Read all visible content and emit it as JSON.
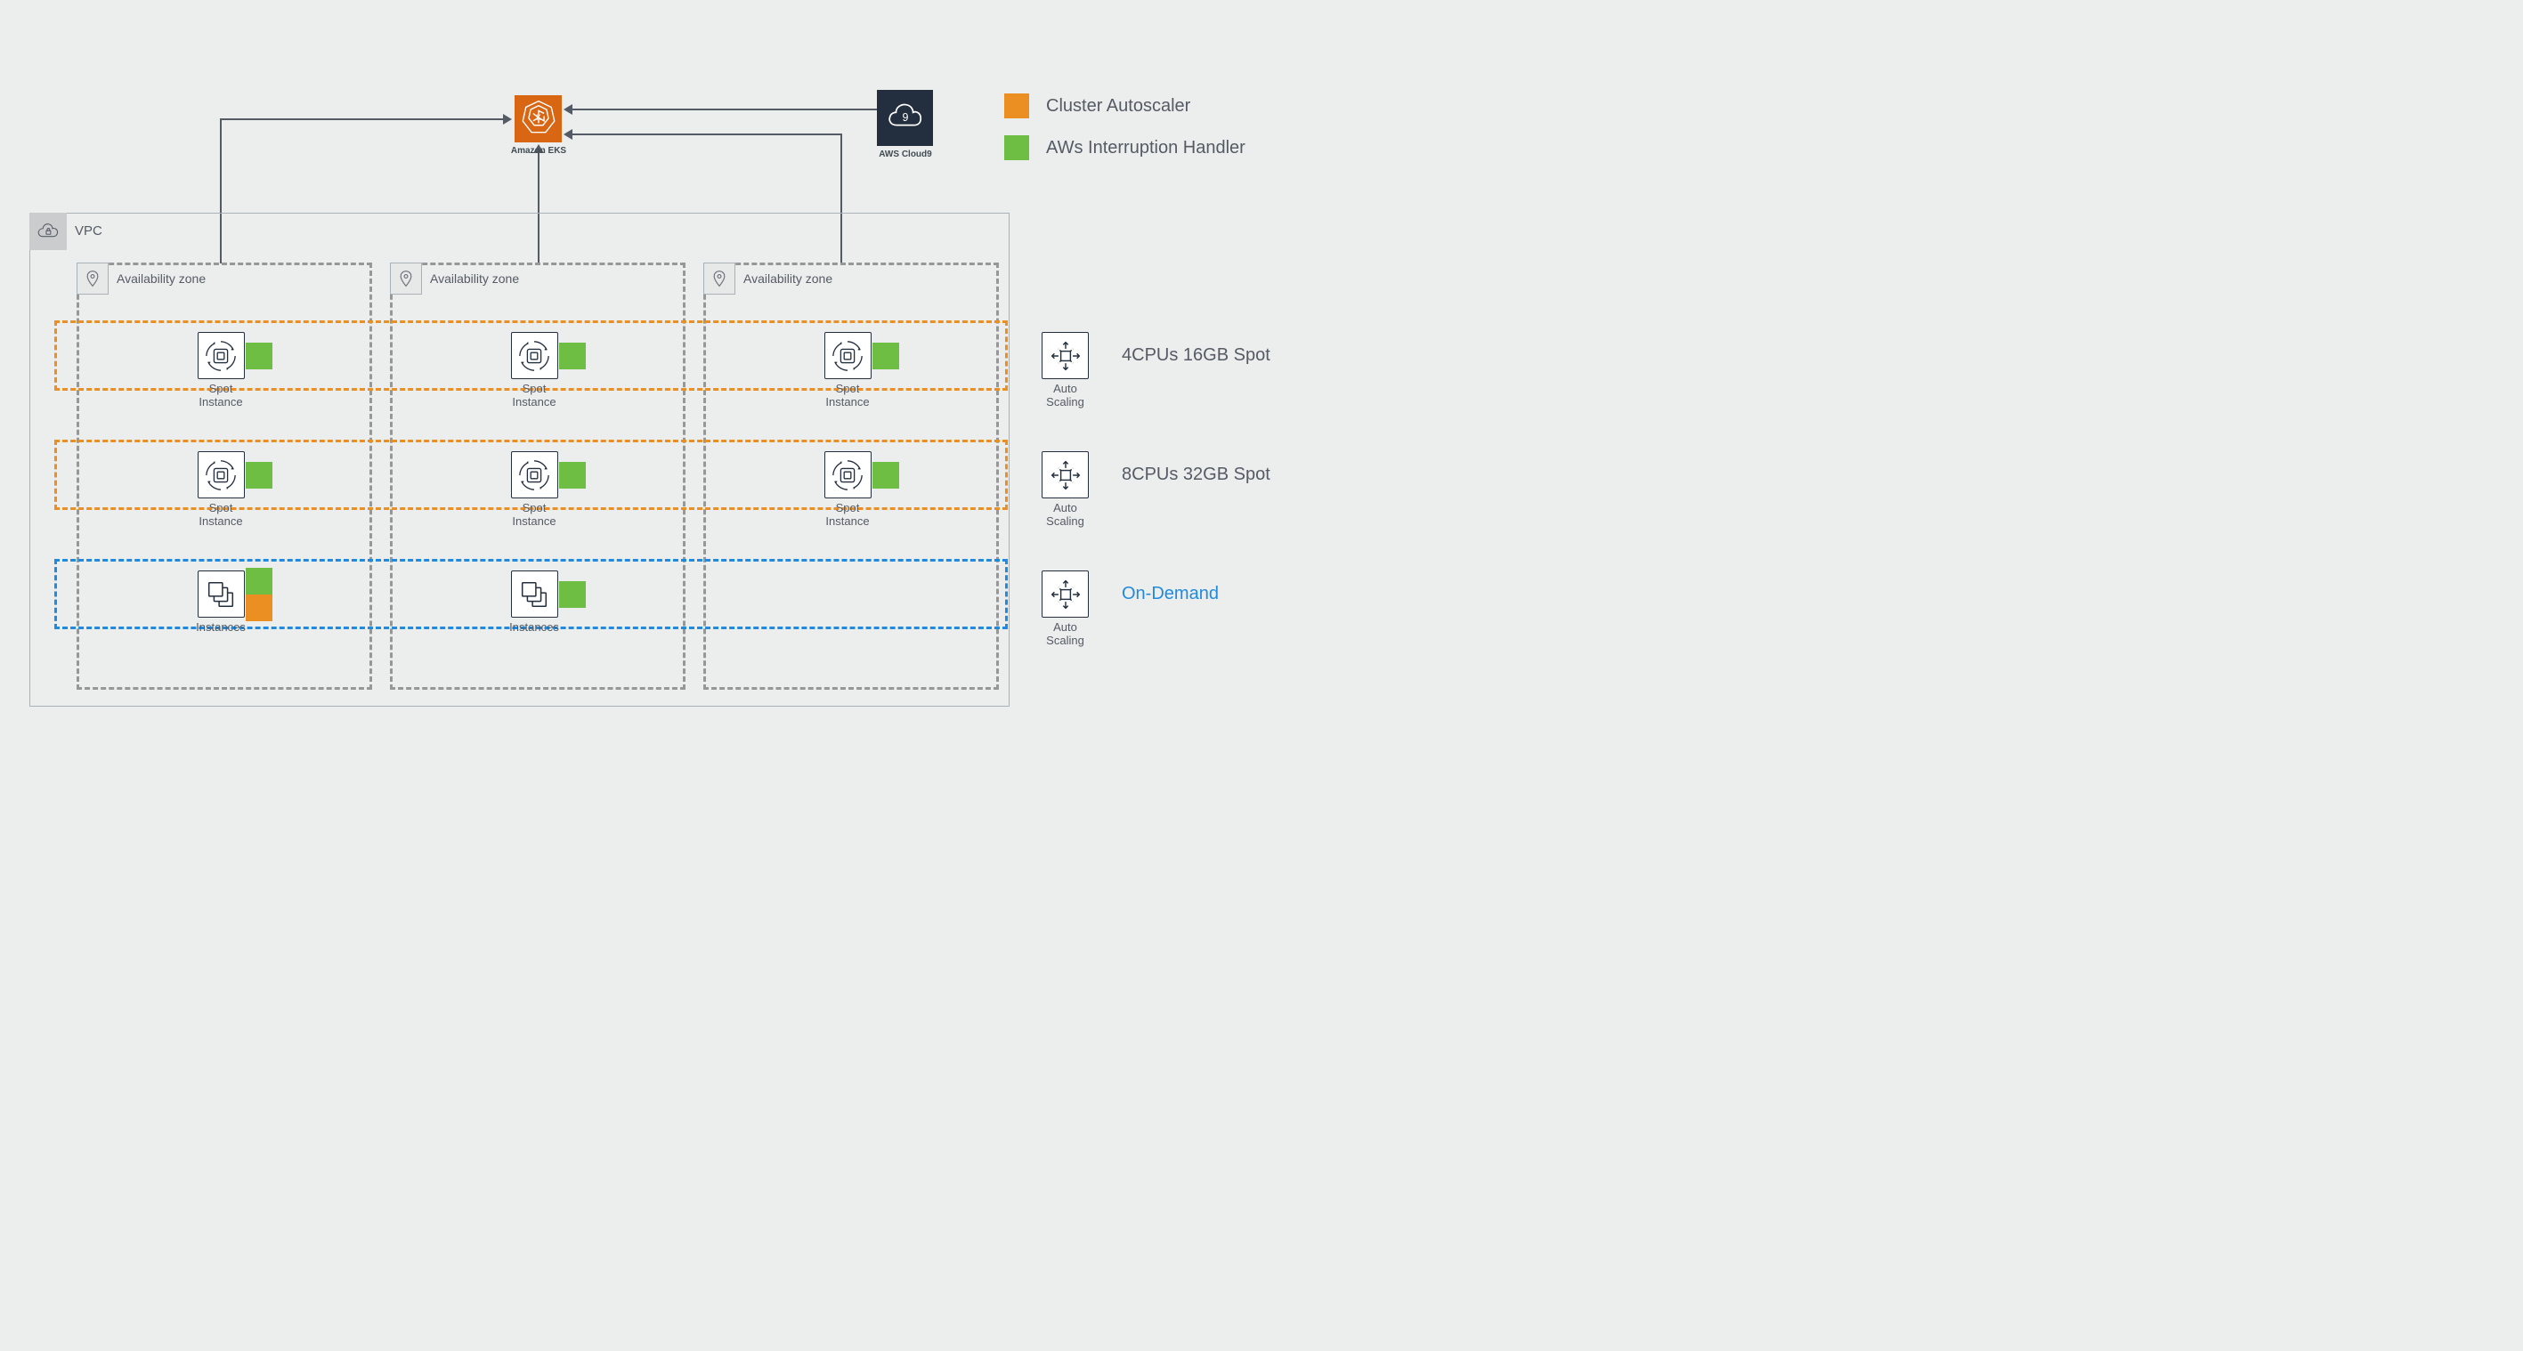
{
  "eks": {
    "label": "Amazon EKS"
  },
  "cloud9": {
    "label": "AWS Cloud9"
  },
  "legend": {
    "orange": "Cluster Autoscaler",
    "green": "AWs Interruption Handler"
  },
  "vpc": {
    "label": "VPC"
  },
  "az": {
    "label": "Availability zone"
  },
  "instances": {
    "spot": "Spot\nInstance",
    "ondemand": "Instances"
  },
  "rows": {
    "r1": {
      "title": "4CPUs 16GB Spot",
      "caption": "Auto\nScaling"
    },
    "r2": {
      "title": "8CPUs 32GB Spot",
      "caption": "Auto\nScaling"
    },
    "r3": {
      "title": "On-Demand",
      "caption": "Auto\nScaling"
    }
  }
}
